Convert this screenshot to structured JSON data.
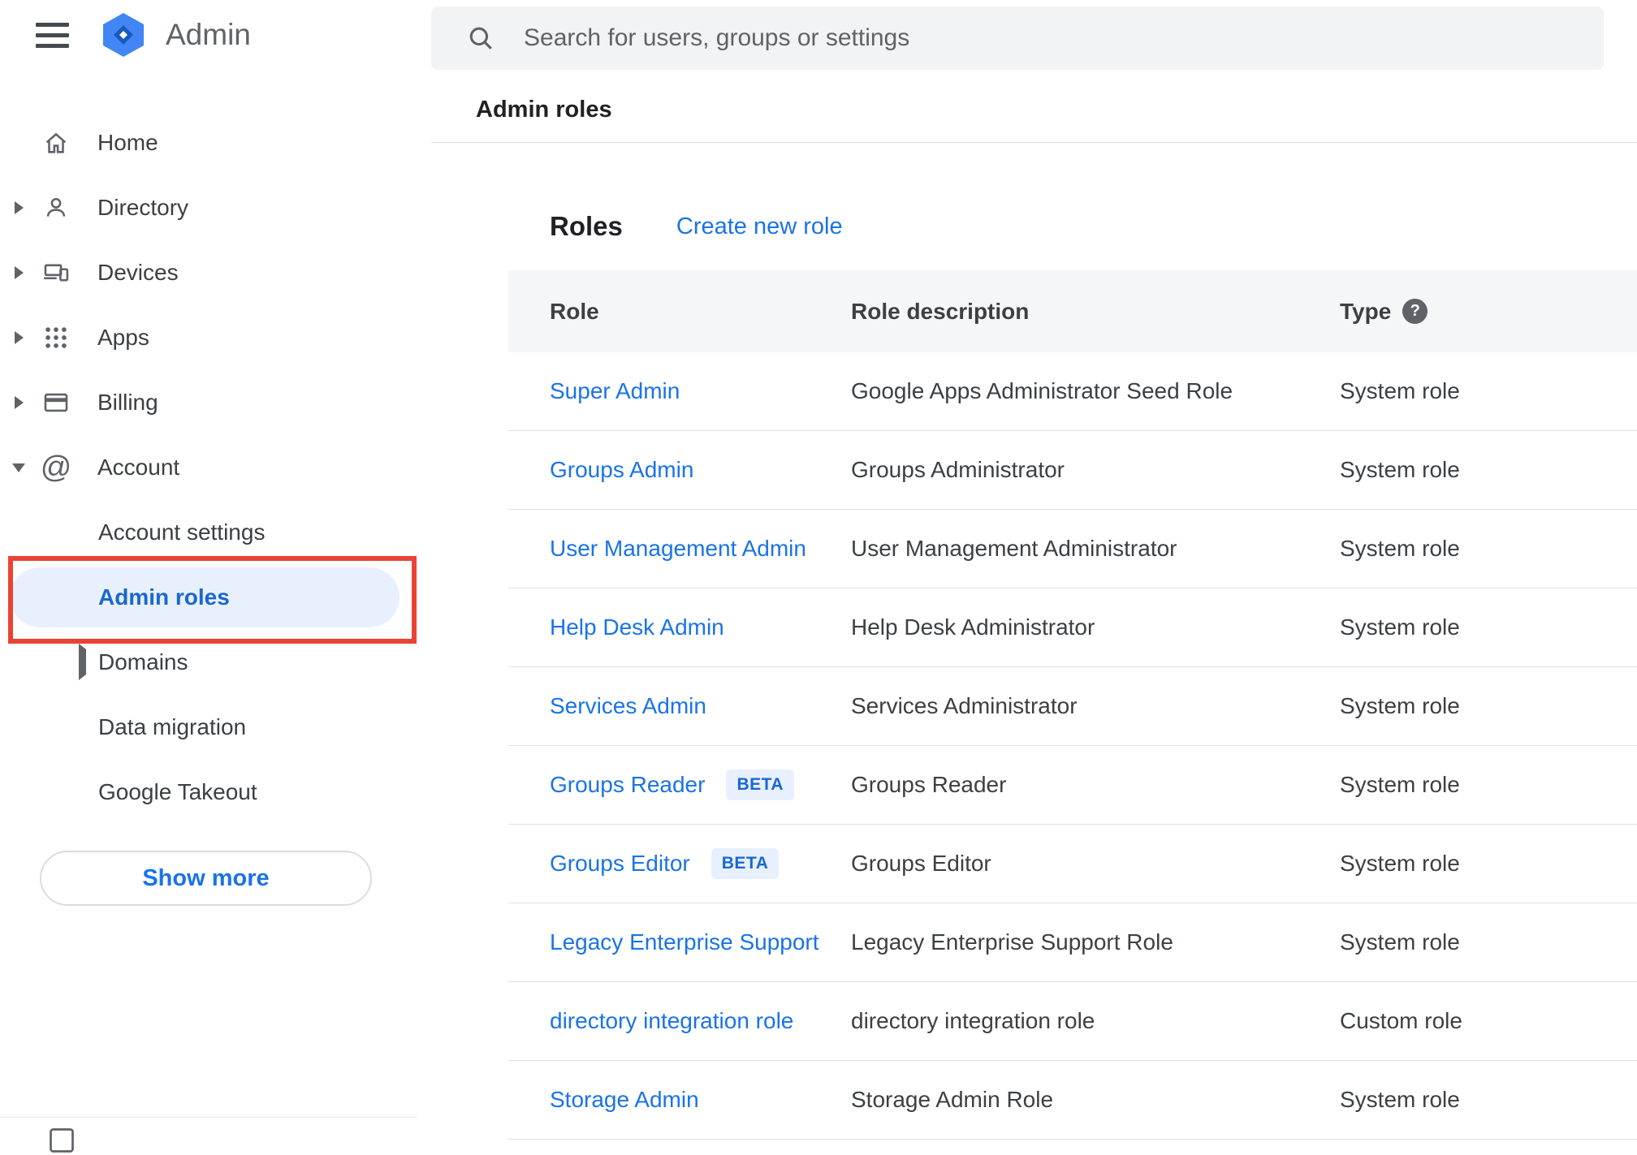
{
  "app": {
    "title": "Admin"
  },
  "search": {
    "placeholder": "Search for users, groups or settings"
  },
  "breadcrumb": "Admin roles",
  "sidebar": {
    "items": [
      {
        "label": "Home"
      },
      {
        "label": "Directory"
      },
      {
        "label": "Devices"
      },
      {
        "label": "Apps"
      },
      {
        "label": "Billing"
      },
      {
        "label": "Account"
      }
    ],
    "account_children": [
      {
        "label": "Account settings"
      },
      {
        "label": "Admin roles",
        "selected": true
      },
      {
        "label": "Domains"
      },
      {
        "label": "Data migration"
      },
      {
        "label": "Google Takeout"
      }
    ],
    "show_more_label": "Show more"
  },
  "main": {
    "card_title": "Roles",
    "create_link_label": "Create new role",
    "columns": {
      "role": "Role",
      "description": "Role description",
      "type": "Type"
    },
    "beta_label": "BETA",
    "help_glyph": "?",
    "rows": [
      {
        "role": "Super Admin",
        "beta": false,
        "description": "Google Apps Administrator Seed Role",
        "type": "System role"
      },
      {
        "role": "Groups Admin",
        "beta": false,
        "description": "Groups Administrator",
        "type": "System role"
      },
      {
        "role": "User Management Admin",
        "beta": false,
        "description": "User Management Administrator",
        "type": "System role"
      },
      {
        "role": "Help Desk Admin",
        "beta": false,
        "description": "Help Desk Administrator",
        "type": "System role"
      },
      {
        "role": "Services Admin",
        "beta": false,
        "description": "Services Administrator",
        "type": "System role"
      },
      {
        "role": "Groups Reader",
        "beta": true,
        "description": "Groups Reader",
        "type": "System role"
      },
      {
        "role": "Groups Editor",
        "beta": true,
        "description": "Groups Editor",
        "type": "System role"
      },
      {
        "role": "Legacy Enterprise Support",
        "beta": false,
        "description": "Legacy Enterprise Support Role",
        "type": "System role"
      },
      {
        "role": "directory integration role",
        "beta": false,
        "description": "directory integration role",
        "type": "Custom role"
      },
      {
        "role": "Storage Admin",
        "beta": false,
        "description": "Storage Admin Role",
        "type": "System role"
      }
    ]
  },
  "colors": {
    "link_blue": "#1a73e8",
    "selected_text": "#1967d2",
    "selected_bg": "#e8f0fe",
    "beta_bg": "#e8f0fe",
    "beta_text": "#1967d2",
    "annotation_red": "#ea4335",
    "search_bg": "#f1f3f4",
    "table_header_bg": "#f5f6f7",
    "divider": "#e0e0e0",
    "text_primary": "#202124",
    "text_secondary": "#5f6368",
    "logo_hex": "#4285f4",
    "logo_diamond": "#185abc"
  }
}
